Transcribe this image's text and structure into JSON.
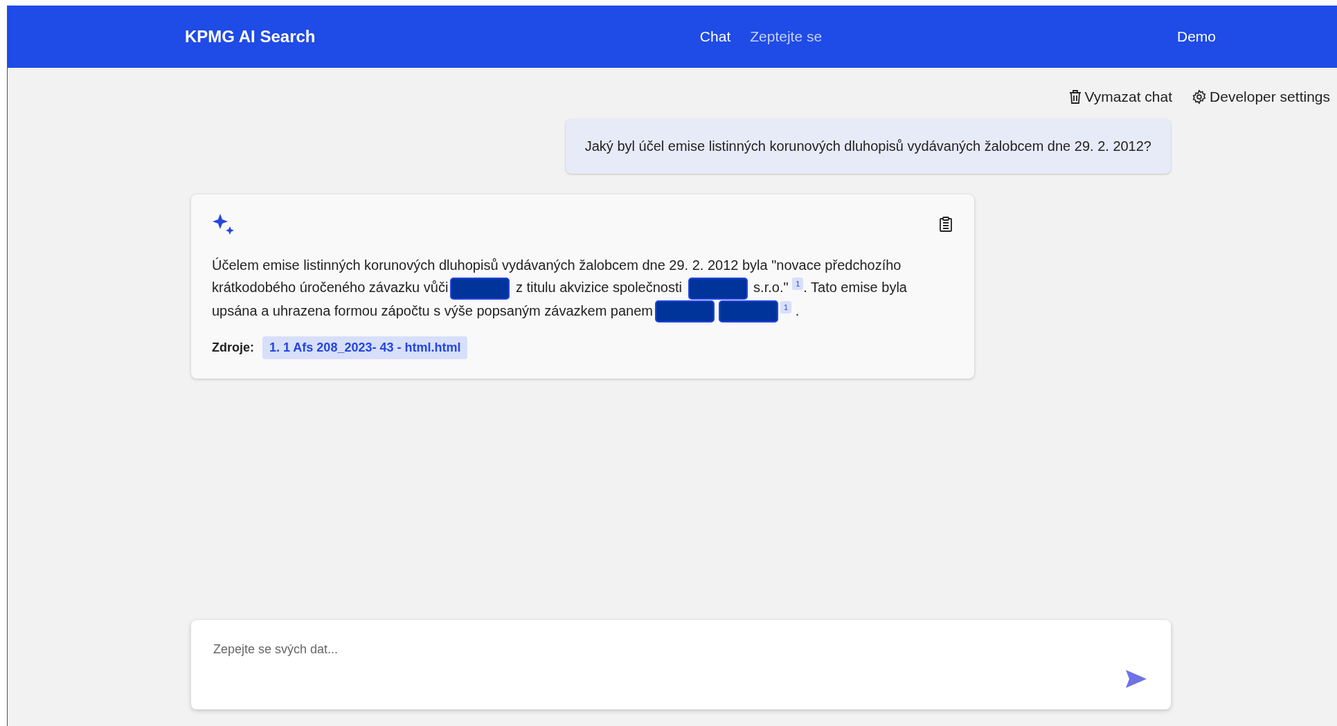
{
  "header": {
    "title": "KPMG AI Search",
    "nav": [
      {
        "label": "Chat",
        "selected": true
      },
      {
        "label": "Zeptejte se",
        "selected": false
      }
    ],
    "user": "Demo"
  },
  "actions": [
    {
      "kind": "trash",
      "label": "Vymazat chat"
    },
    {
      "kind": "gear",
      "label": "Developer settings"
    }
  ],
  "question": "Jaký byl účel emise listinných korunových dluhopisů vydávaných žalobcem dne 29. 2. 2012?",
  "answer": {
    "parts": [
      {
        "kind": "text",
        "text": "Účelem emise listinných korunových dluhopisů vydávaných žalobcem dne 29. 2. 2012 byla \"novace předchozího krátkodobého úročeného závazku vůči"
      },
      {
        "kind": "redaction"
      },
      {
        "kind": "text",
        "text": " z titulu akvizice společnosti "
      },
      {
        "kind": "redaction"
      },
      {
        "kind": "text",
        "text": " s.r.o.\" "
      },
      {
        "kind": "citation",
        "text": "1"
      },
      {
        "kind": "text",
        "text": ". Tato emise byla upsána a uhrazena formou zápočtu s výše popsaným závazkem panem"
      },
      {
        "kind": "redaction"
      },
      {
        "kind": "redaction"
      },
      {
        "kind": "citation",
        "text": "1"
      },
      {
        "kind": "text",
        "text": " ."
      }
    ],
    "sources_label": "Zdroje:",
    "sources": [
      "1. 1 Afs 208_2023- 43 - html.html"
    ]
  },
  "input": {
    "placeholder": "Zepejte se svých dat..."
  }
}
